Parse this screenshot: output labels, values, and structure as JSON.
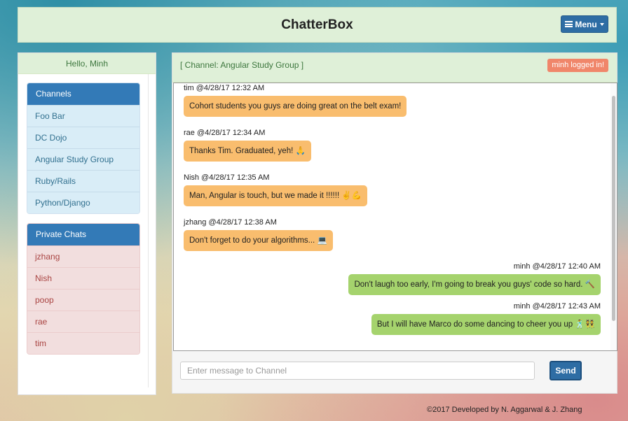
{
  "header": {
    "title": "ChatterBox",
    "menu_label": "Menu"
  },
  "sidebar": {
    "greeting": "Hello, Minh",
    "channels_title": "Channels",
    "channels": [
      "Foo Bar",
      "DC Dojo",
      "Angular Study Group",
      "Ruby/Rails",
      "Python/Django"
    ],
    "private_title": "Private Chats",
    "private_chats": [
      "jzhang",
      "Nish",
      "poop",
      "rae",
      "tim"
    ]
  },
  "chat": {
    "channel_label": "[ Channel: Angular Study Group ]",
    "login_badge": "minh logged in!",
    "messages": [
      {
        "meta": "tim @4/28/17 12:32 AM",
        "text": "Cohort students you guys are doing great on the belt exam!",
        "side": "left"
      },
      {
        "meta": "rae @4/28/17 12:34 AM",
        "text": "Thanks Tim. Graduated, yeh! 🙏",
        "side": "left"
      },
      {
        "meta": "Nish @4/28/17 12:35 AM",
        "text": "Man, Angular is touch, but we made it !!!!!! ✌️💪",
        "side": "left"
      },
      {
        "meta": "jzhang @4/28/17 12:38 AM",
        "text": "Don't forget to do your algorithms... 💻",
        "side": "left"
      },
      {
        "meta": "minh @4/28/17 12:40 AM",
        "text": "Don't laugh too early, I'm going to break you guys' code so hard. 🔨",
        "side": "right"
      },
      {
        "meta": "minh @4/28/17 12:43 AM",
        "text": "But I will have Marco do some dancing to cheer you up 🕺👯",
        "side": "right"
      }
    ],
    "input_placeholder": "Enter message to Channel",
    "input_value": "",
    "send_label": "Send"
  },
  "footer": {
    "text": "©2017 Developed by N. Aggarwal & J. Zhang"
  },
  "colors": {
    "primary": "#337ab7",
    "success_bg": "#dff0d8",
    "their_bubble": "#f9bd6e",
    "my_bubble": "#a5d36d",
    "badge": "#f0866a"
  }
}
